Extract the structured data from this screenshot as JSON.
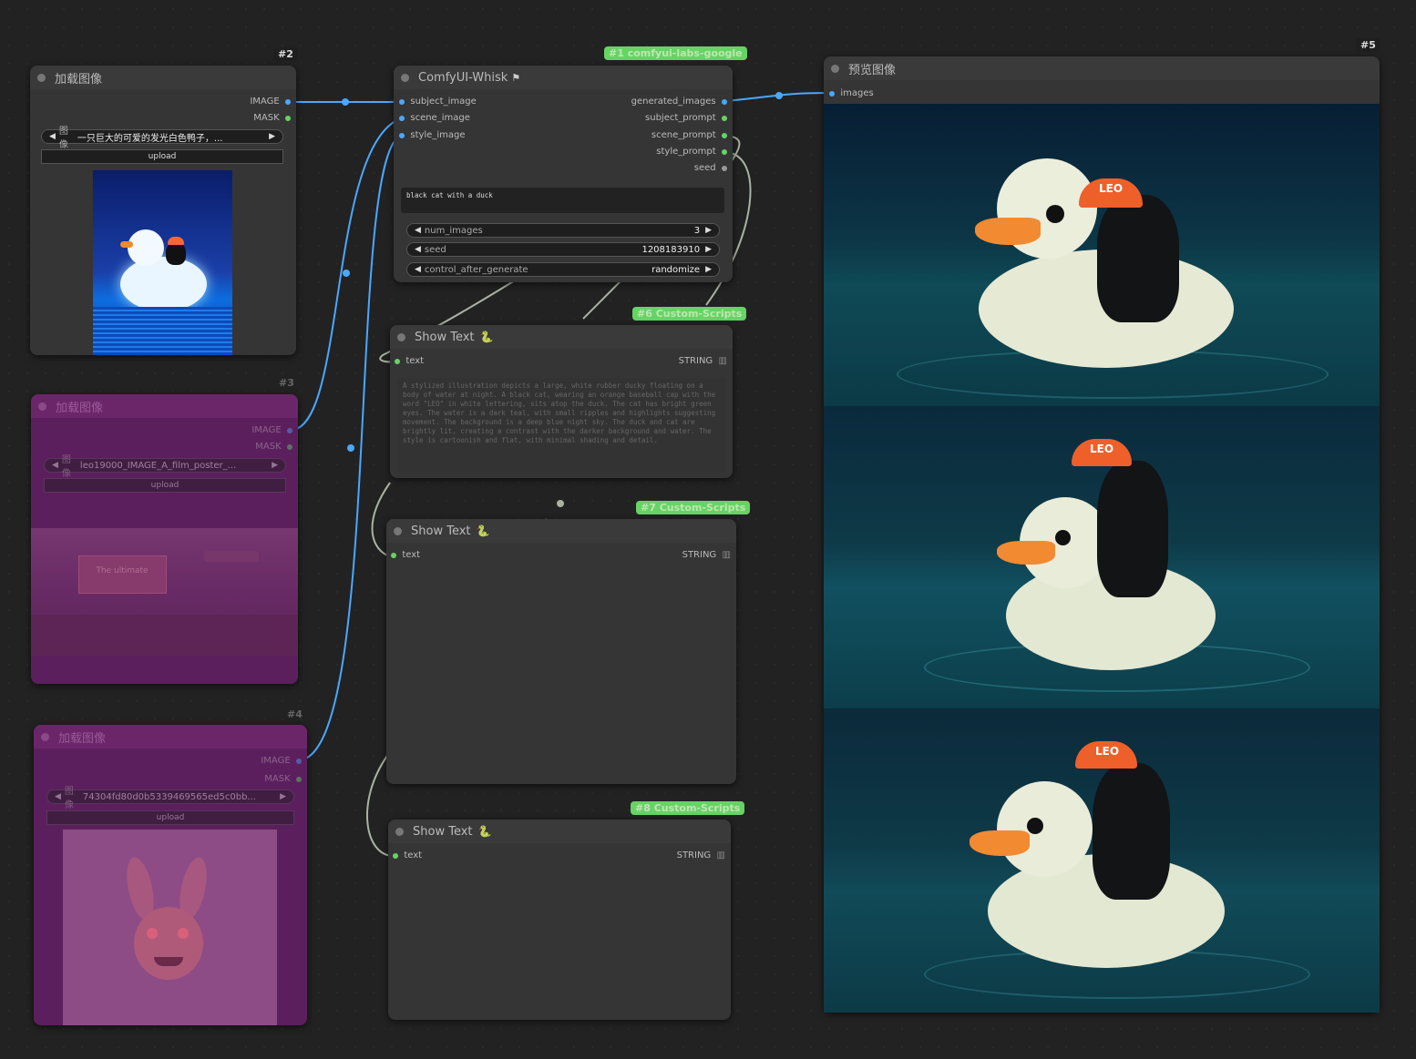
{
  "nodes": {
    "load2": {
      "badge": "#2",
      "title": "加载图像",
      "out_image": "IMAGE",
      "out_mask": "MASK",
      "widget_name": "图像",
      "widget_value": "一只巨大的可爱的发光白色鸭子，...",
      "upload": "upload"
    },
    "load3": {
      "badge": "#3",
      "title": "加载图像",
      "out_image": "IMAGE",
      "out_mask": "MASK",
      "widget_name": "图像",
      "widget_value": "leo19000_IMAGE_A_film_poster_...",
      "upload": "upload",
      "overlay_text": "The ultimate"
    },
    "load4": {
      "badge": "#4",
      "title": "加载图像",
      "out_image": "IMAGE",
      "out_mask": "MASK",
      "widget_name": "图像",
      "widget_value": "74304fd80d0b5339469565ed5c0bb...",
      "upload": "upload"
    },
    "whisk": {
      "badge": "#1 comfyui-labs-google",
      "title": "ComfyUI-Whisk",
      "inputs": [
        "subject_image",
        "scene_image",
        "style_image"
      ],
      "outputs": [
        "generated_images",
        "subject_prompt",
        "scene_prompt",
        "style_prompt",
        "seed"
      ],
      "prompt": "black cat with a duck",
      "num_images_label": "num_images",
      "num_images_value": "3",
      "seed_label": "seed",
      "seed_value": "1208183910",
      "control_label": "control_after_generate",
      "control_value": "randomize"
    },
    "show6": {
      "badge": "#6 Custom-Scripts",
      "title": "Show Text",
      "in_text": "text",
      "out_string": "STRING",
      "content": "A stylized illustration depicts a large, white rubber ducky floating on a body of water at night.  A black cat, wearing an orange baseball cap with the word \"LEO\" in white lettering, sits atop the duck. The cat has bright green eyes. The water is a dark teal, with small ripples and highlights suggesting movement. The background is a deep blue night sky. The duck and cat are brightly lit, creating a contrast with the darker background and water. The style is cartoonish and flat, with minimal shading and detail."
    },
    "show7": {
      "badge": "#7 Custom-Scripts",
      "title": "Show Text",
      "in_text": "text",
      "out_string": "STRING"
    },
    "show8": {
      "badge": "#8 Custom-Scripts",
      "title": "Show Text",
      "in_text": "text",
      "out_string": "STRING"
    },
    "preview": {
      "badge": "#5",
      "title": "预览图像",
      "in_images": "images",
      "cap_text": "LEO"
    }
  },
  "colors": {
    "canvas": "#222222",
    "node": "#353535",
    "bypass": "#5c1f5e",
    "image_link": "#4aa8ff",
    "string_link": "#65d465",
    "accent": "#f2683a"
  }
}
